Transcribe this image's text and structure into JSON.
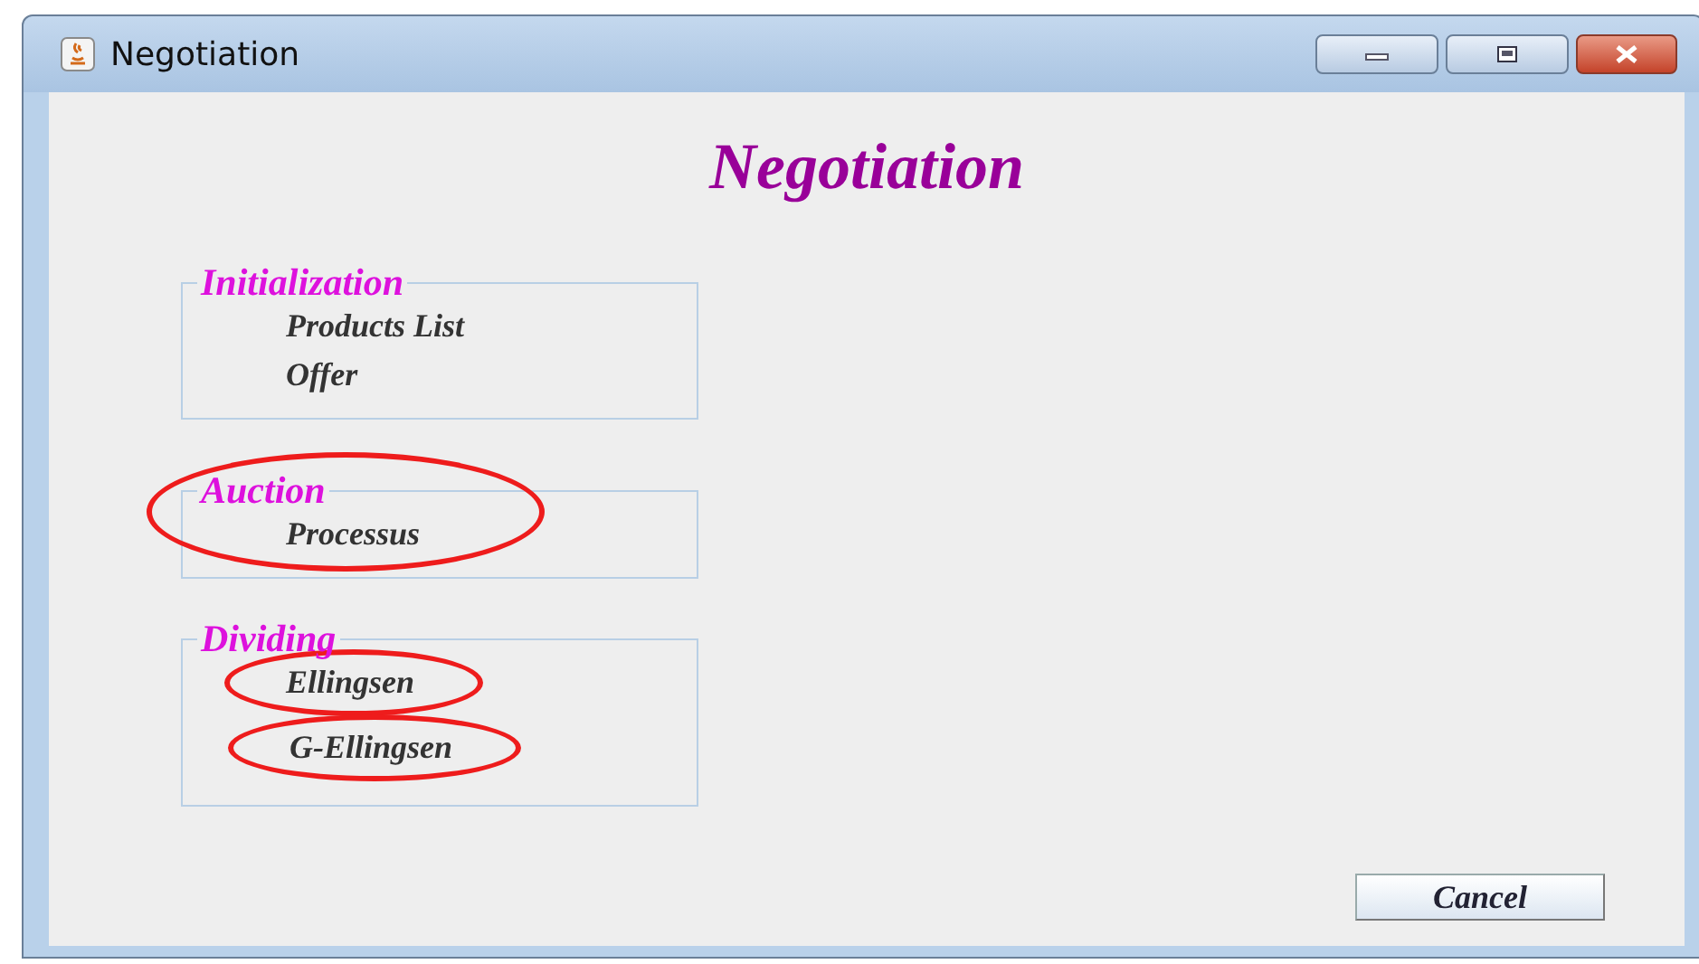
{
  "window": {
    "title": "Negotiation"
  },
  "heading": "Negotiation",
  "groups": [
    {
      "title": "Initialization",
      "circled": false,
      "items": [
        {
          "label": "Products List",
          "circled": false
        },
        {
          "label": "Offer",
          "circled": false
        }
      ]
    },
    {
      "title": "Auction",
      "circled": true,
      "items": [
        {
          "label": "Processus",
          "circled": false
        }
      ]
    },
    {
      "title": "Dividing",
      "circled": false,
      "items": [
        {
          "label": "Ellingsen",
          "circled": true
        },
        {
          "label": "G-Ellingsen",
          "circled": true
        }
      ]
    }
  ],
  "buttons": [
    {
      "label": "Cancel"
    }
  ]
}
